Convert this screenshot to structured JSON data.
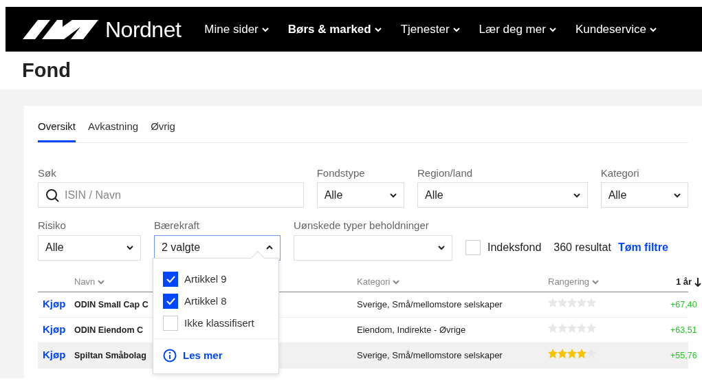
{
  "brand": {
    "name": "Nordnet"
  },
  "nav": [
    {
      "label": "Mine sider",
      "selected": false
    },
    {
      "label": "Børs & marked",
      "selected": true
    },
    {
      "label": "Tjenester",
      "selected": false
    },
    {
      "label": "Lær deg mer",
      "selected": false
    },
    {
      "label": "Kundeservice",
      "selected": false
    }
  ],
  "page_title": "Fond",
  "tabs": [
    {
      "label": "Oversikt",
      "selected": true
    },
    {
      "label": "Avkastning",
      "selected": false
    },
    {
      "label": "Øvrig",
      "selected": false
    }
  ],
  "search": {
    "label": "Søk",
    "placeholder": "ISIN / Navn"
  },
  "filters_row1": [
    {
      "label": "Fondstype",
      "value": "Alle"
    },
    {
      "label": "Region/land",
      "value": "Alle"
    },
    {
      "label": "Kategori",
      "value": "Alle"
    }
  ],
  "filters_row2": [
    {
      "label": "Risiko",
      "value": "Alle",
      "expanded": false
    },
    {
      "label": "Bærekraft",
      "value": "2 valgte",
      "expanded": true
    },
    {
      "label": "Uønskede typer beholdninger",
      "expanded": false
    }
  ],
  "index_fund": {
    "label": "Indeksfond",
    "checked": false
  },
  "result_count": "360 resultat",
  "clear_filters": "Tøm filtre",
  "sustainability_menu": {
    "options": [
      {
        "label": "Artikkel 9",
        "checked": true
      },
      {
        "label": "Artikkel 8",
        "checked": true
      },
      {
        "label": "Ikke klassifisert",
        "checked": false
      }
    ],
    "link": "Les mer"
  },
  "table": {
    "columns": [
      "Navn",
      "Kategori",
      "Rangering",
      "1 år"
    ],
    "rows": [
      {
        "action": "Kjøp",
        "name": "ODIN Small Cap C",
        "category": "Sverige, Små/mellomstore selskaper",
        "stars": 0,
        "return_1y": "+67,40",
        "hovered": false
      },
      {
        "action": "Kjøp",
        "name": "ODIN Eiendom C",
        "category": "Eiendom, Indirekte - Øvrige",
        "stars": 0,
        "return_1y": "+63,51",
        "hovered": false
      },
      {
        "action": "Kjøp",
        "name": "Spiltan Småbolag",
        "category": "Sverige, Små/mellomstore selskaper",
        "stars": 4,
        "return_1y": "+55,76",
        "hovered": true
      }
    ]
  }
}
